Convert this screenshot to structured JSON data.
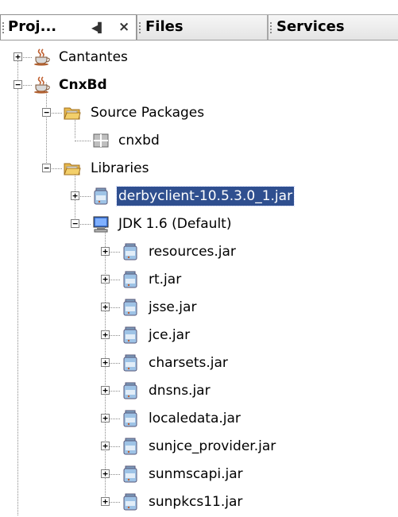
{
  "tabs": [
    {
      "label": "Proj...",
      "active": true
    },
    {
      "label": "Files",
      "active": false
    },
    {
      "label": "Services",
      "active": false
    }
  ],
  "tab_controls": {
    "minimize": "◀▌",
    "close": "×"
  },
  "colors": {
    "selection_bg": "#2f4f8f",
    "selection_fg": "#ffffff",
    "folder": "#e8b84a",
    "jar": "#9ec3e6",
    "coffee": "#c06030"
  },
  "tree": [
    {
      "label": "Cantantes",
      "icon": "coffee-cup-icon",
      "expander": "+",
      "bold": false
    },
    {
      "label": "CnxBd",
      "icon": "coffee-cup-icon",
      "expander": "-",
      "bold": true
    },
    {
      "label": "Source Packages",
      "icon": "folder-icon",
      "expander": "-"
    },
    {
      "label": "cnxbd",
      "icon": "package-icon",
      "expander": ""
    },
    {
      "label": "Libraries",
      "icon": "folder-icon",
      "expander": "-"
    },
    {
      "label": "derbyclient-10.5.3.0_1.jar",
      "icon": "jar-icon",
      "expander": "+",
      "selected": true
    },
    {
      "label": "JDK 1.6 (Default)",
      "icon": "computer-icon",
      "expander": "-"
    },
    {
      "label": "resources.jar",
      "icon": "jar-icon",
      "expander": "+"
    },
    {
      "label": "rt.jar",
      "icon": "jar-icon",
      "expander": "+"
    },
    {
      "label": "jsse.jar",
      "icon": "jar-icon",
      "expander": "+"
    },
    {
      "label": "jce.jar",
      "icon": "jar-icon",
      "expander": "+"
    },
    {
      "label": "charsets.jar",
      "icon": "jar-icon",
      "expander": "+"
    },
    {
      "label": "dnsns.jar",
      "icon": "jar-icon",
      "expander": "+"
    },
    {
      "label": "localedata.jar",
      "icon": "jar-icon",
      "expander": "+"
    },
    {
      "label": "sunjce_provider.jar",
      "icon": "jar-icon",
      "expander": "+"
    },
    {
      "label": "sunmscapi.jar",
      "icon": "jar-icon",
      "expander": "+"
    },
    {
      "label": "sunpkcs11.jar",
      "icon": "jar-icon",
      "expander": "+"
    }
  ]
}
